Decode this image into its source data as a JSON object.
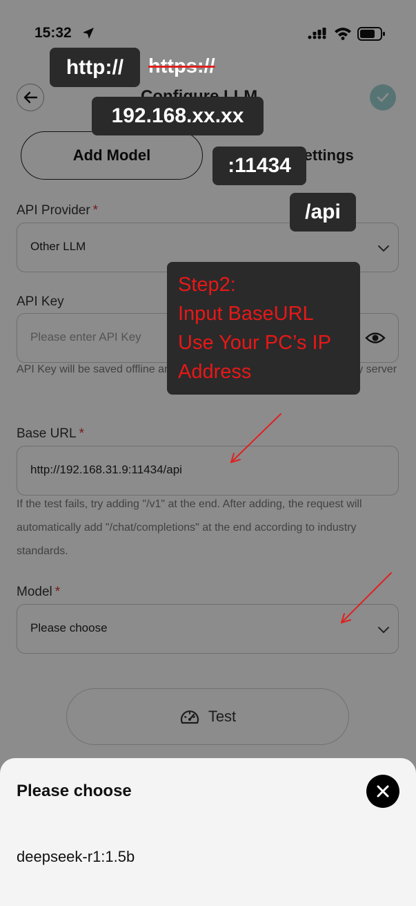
{
  "status_bar": {
    "time": "15:32"
  },
  "header": {
    "title": "Configure LLM"
  },
  "tabs": {
    "add_model": "Add Model",
    "settings": "Settings"
  },
  "api_provider": {
    "label": "API Provider",
    "required_mark": "*",
    "value": "Other LLM"
  },
  "api_key": {
    "label": "API Key",
    "placeholder": "Please enter API Key",
    "hint": "API Key will be saved offline and will not be uploaded to any third-party server"
  },
  "base_url": {
    "label": "Base URL",
    "required_mark": "*",
    "value": "http://192.168.31.9:11434/api",
    "hint": "If the test fails, try adding \"/v1\" at the end. After adding, the request will automatically add \"/chat/completions\" at the end according to industry standards."
  },
  "model": {
    "label": "Model",
    "required_mark": "*",
    "value": "Please choose"
  },
  "test_button": {
    "label": "Test"
  },
  "annotations": {
    "http": "http://",
    "https": "https://",
    "ip": "192.168.xx.xx",
    "port": ":11434",
    "api": "/api",
    "step": [
      "Step2:",
      "Input BaseURL",
      "Use Your PC’s IP",
      "Address"
    ],
    "arrow_color": "#e02020"
  },
  "sheet": {
    "title": "Please choose",
    "option": "deepseek-r1:1.5b"
  },
  "colors": {
    "accent_teal": "#9fd4d4",
    "required_red": "#d93030",
    "annotation_red": "#e81818"
  }
}
